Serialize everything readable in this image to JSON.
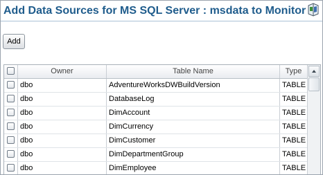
{
  "header": {
    "title": "Add Data Sources for MS SQL Server : msdata to Monitor",
    "help_icon": "help-book-icon"
  },
  "toolbar": {
    "add_label": "Add"
  },
  "grid": {
    "columns": [
      "",
      "Owner",
      "Table Name",
      "Type"
    ],
    "rows": [
      {
        "owner": "dbo",
        "table": "AdventureWorksDWBuildVersion",
        "type": "TABLE"
      },
      {
        "owner": "dbo",
        "table": "DatabaseLog",
        "type": "TABLE"
      },
      {
        "owner": "dbo",
        "table": "DimAccount",
        "type": "TABLE"
      },
      {
        "owner": "dbo",
        "table": "DimCurrency",
        "type": "TABLE"
      },
      {
        "owner": "dbo",
        "table": "DimCustomer",
        "type": "TABLE"
      },
      {
        "owner": "dbo",
        "table": "DimDepartmentGroup",
        "type": "TABLE"
      },
      {
        "owner": "dbo",
        "table": "DimEmployee",
        "type": "TABLE"
      }
    ]
  },
  "colors": {
    "title": "#1f5c8c",
    "border": "#a8b0b8"
  }
}
